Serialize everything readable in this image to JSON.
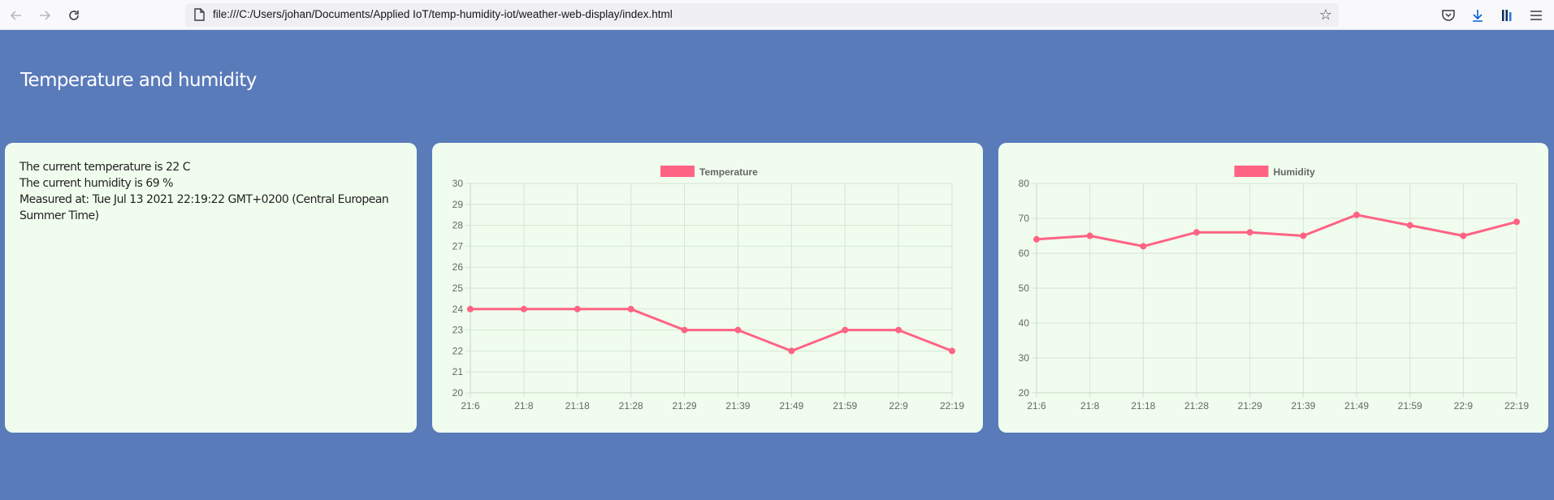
{
  "browser": {
    "url": "file:///C:/Users/johan/Documents/Applied IoT/temp-humidity-iot/weather-web-display/index.html",
    "icons": [
      "back-arrow-icon",
      "forward-arrow-icon",
      "reload-icon",
      "page-icon",
      "bookmark-star-icon",
      "pocket-icon",
      "download-icon",
      "library-icon",
      "menu-icon"
    ]
  },
  "page": {
    "title": "Temperature and humidity",
    "current_temperature": "The current temperature is 22 C",
    "current_humidity": "The current humidity is 69 %",
    "measured_at": "Measured at: Tue Jul 13 2021 22:19:22 GMT+0200 (Central European Summer Time)"
  },
  "colors": {
    "background": "#5a7bba",
    "card": "#f0fdee",
    "series": "#ff6384",
    "grid": "#d6e4d4"
  },
  "chart_data": [
    {
      "type": "line",
      "x": [
        "21:6",
        "21:8",
        "21:18",
        "21:28",
        "21:29",
        "21:39",
        "21:49",
        "21:59",
        "22:9",
        "22:19"
      ],
      "series": [
        {
          "name": "Temperature",
          "values": [
            24,
            24,
            24,
            24,
            23,
            23,
            22,
            23,
            23,
            22
          ]
        }
      ],
      "ylim": [
        20,
        30
      ],
      "yticks": [
        20,
        21,
        22,
        23,
        24,
        25,
        26,
        27,
        28,
        29,
        30
      ],
      "grid": true,
      "legend": "top"
    },
    {
      "type": "line",
      "x": [
        "21:6",
        "21:8",
        "21:18",
        "21:28",
        "21:29",
        "21:39",
        "21:49",
        "21:59",
        "22:9",
        "22:19"
      ],
      "series": [
        {
          "name": "Humidity",
          "values": [
            64,
            65,
            62,
            66,
            66,
            65,
            71,
            68,
            65,
            69
          ]
        }
      ],
      "ylim": [
        20,
        80
      ],
      "yticks": [
        20,
        30,
        40,
        50,
        60,
        70,
        80
      ],
      "grid": true,
      "legend": "top"
    }
  ]
}
